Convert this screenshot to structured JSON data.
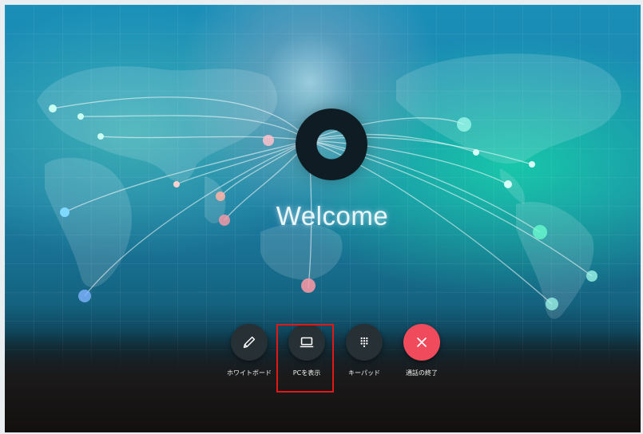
{
  "welcome_text": "Welcome",
  "controls": [
    {
      "label": "ホワイトボード",
      "icon": "pencil-icon"
    },
    {
      "label": "PCを表示",
      "icon": "laptop-icon"
    },
    {
      "label": "キーパッド",
      "icon": "keypad-icon"
    },
    {
      "label": "通話の終了",
      "icon": "close-icon"
    }
  ],
  "colors": {
    "background": "#1a8fb8",
    "button": "#263035",
    "end_call": "#f04b5d",
    "highlight": "#e01818"
  }
}
